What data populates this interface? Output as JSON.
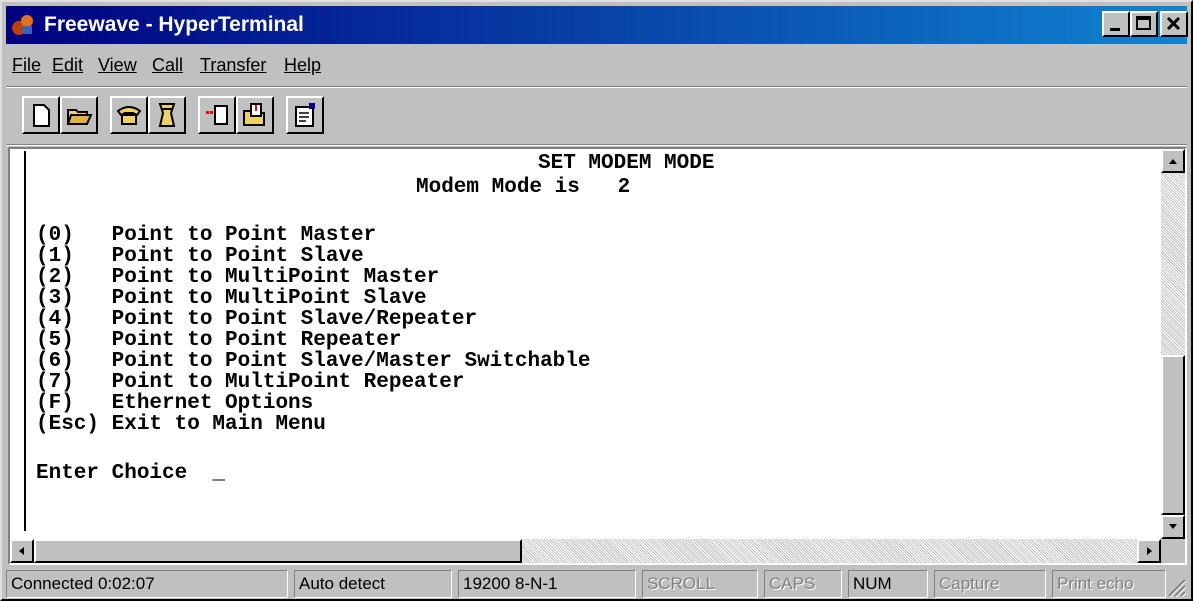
{
  "window": {
    "title": "Freewave - HyperTerminal"
  },
  "menu": [
    {
      "label": "File"
    },
    {
      "label": "Edit"
    },
    {
      "label": "View"
    },
    {
      "label": "Call"
    },
    {
      "label": "Transfer"
    },
    {
      "label": "Help"
    }
  ],
  "toolbar": [
    "new-icon",
    "open-icon",
    "connect-icon",
    "disconnect-icon",
    "send-icon",
    "receive-icon",
    "properties-icon"
  ],
  "terminal": {
    "heading": "SET MODEM MODE",
    "mode_line": "Modem Mode is   2",
    "options": [
      "(0)   Point to Point Master",
      "(1)   Point to Point Slave",
      "(2)   Point to MultiPoint Master",
      "(3)   Point to MultiPoint Slave",
      "(4)   Point to Point Slave/Repeater",
      "(5)   Point to Point Repeater",
      "(6)   Point to Point Slave/Master Switchable",
      "(7)   Point to MultiPoint Repeater",
      "(F)   Ethernet Options",
      "(Esc) Exit to Main Menu"
    ],
    "prompt": "Enter Choice  _"
  },
  "status": {
    "connected": "Connected 0:02:07",
    "detect": "Auto detect",
    "settings": "19200 8-N-1",
    "scroll": "SCROLL",
    "caps": "CAPS",
    "num": "NUM",
    "capture": "Capture",
    "print": "Print echo"
  }
}
